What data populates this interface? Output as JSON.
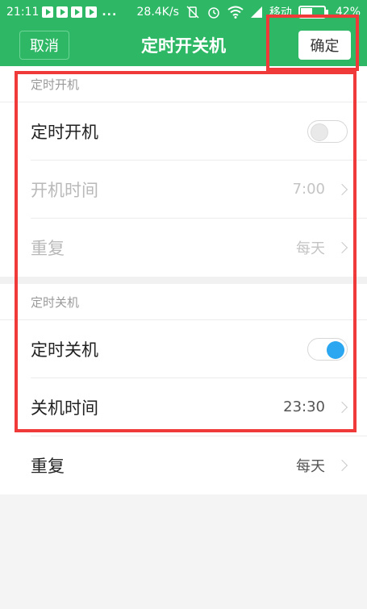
{
  "status_bar": {
    "time": "21:11",
    "dots": "...",
    "speed": "28.4K/s",
    "carrier": "移动",
    "battery": "42%"
  },
  "app_bar": {
    "cancel_label": "取消",
    "title": "定时开关机",
    "confirm_label": "确定"
  },
  "power_on": {
    "header": "定时开机",
    "toggle_label": "定时开机",
    "toggle_on": false,
    "time_label": "开机时间",
    "time_value": "7:00",
    "repeat_label": "重复",
    "repeat_value": "每天"
  },
  "power_off": {
    "header": "定时关机",
    "toggle_label": "定时关机",
    "toggle_on": true,
    "time_label": "关机时间",
    "time_value": "23:30",
    "repeat_label": "重复",
    "repeat_value": "每天"
  },
  "colors": {
    "accent": "#2eb865",
    "toggle_on": "#2aa7f0",
    "highlight": "#f03a3a"
  }
}
